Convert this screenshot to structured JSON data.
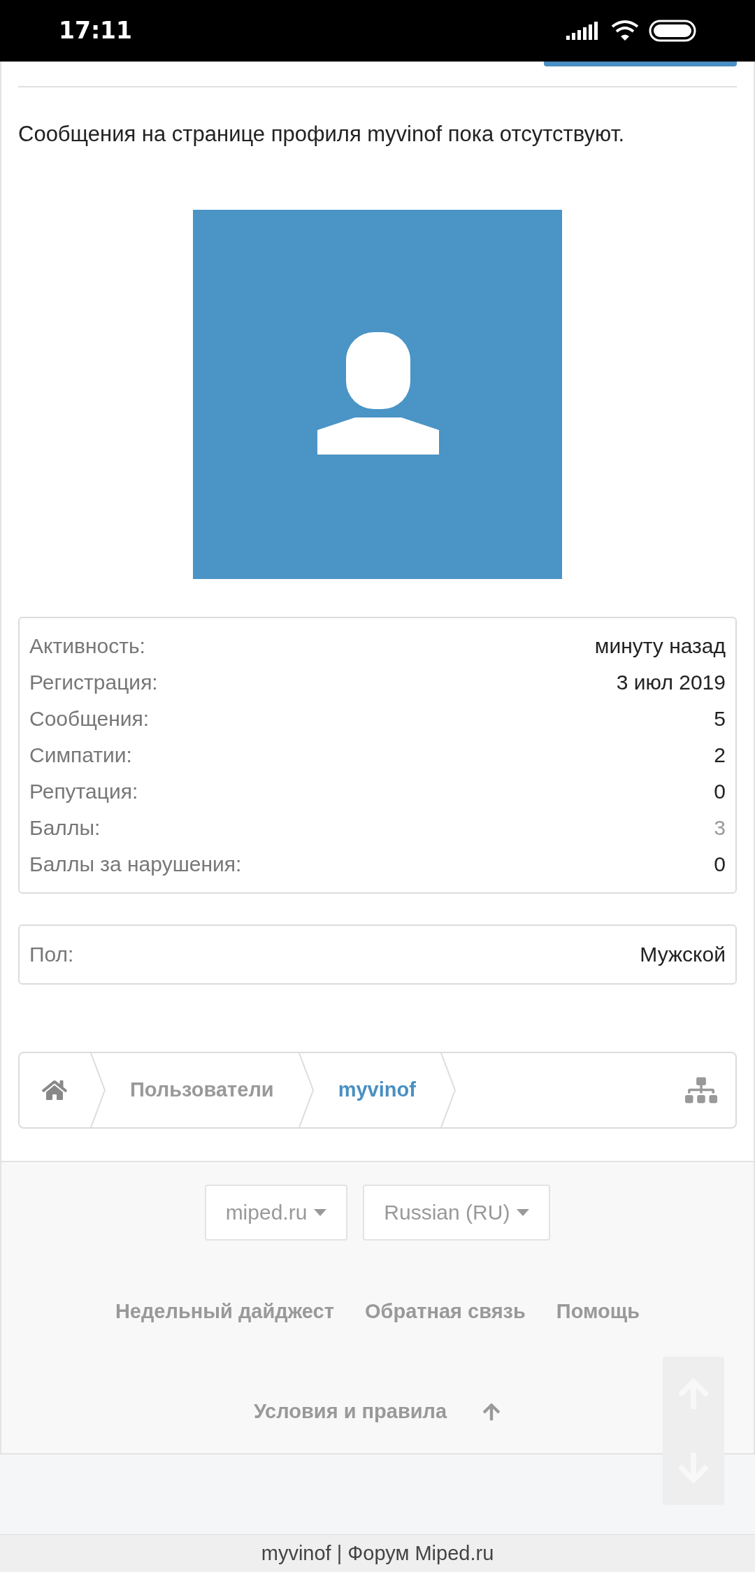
{
  "status_bar": {
    "time": "17:11"
  },
  "message": "Сообщения на странице профиля myvinof пока отсутствуют.",
  "avatar": {
    "kind": "placeholder"
  },
  "stats": [
    {
      "label": "Активность:",
      "value": "минуту назад",
      "kind": "text"
    },
    {
      "label": "Регистрация:",
      "value": "3 июл 2019",
      "kind": "text"
    },
    {
      "label": "Сообщения:",
      "value": "5",
      "kind": "text"
    },
    {
      "label": "Симпатии:",
      "value": "2",
      "kind": "text"
    },
    {
      "label": "Репутация:",
      "value": "0",
      "kind": "text"
    },
    {
      "label": "Баллы:",
      "value": "3",
      "kind": "link"
    },
    {
      "label": "Баллы за нарушения:",
      "value": "0",
      "kind": "text"
    }
  ],
  "about": [
    {
      "label": "Пол:",
      "value": "Мужской"
    }
  ],
  "breadcrumb": [
    {
      "label": "Пользователи",
      "selected": false
    },
    {
      "label": "myvinof",
      "selected": true
    }
  ],
  "footer": {
    "selects": [
      "miped.ru",
      "Russian (RU)"
    ],
    "links": [
      "Недельный дайджест",
      "Обратная связь",
      "Помощь",
      "Условия и правила"
    ]
  },
  "page_title": "myvinof | Форум Miped.ru"
}
